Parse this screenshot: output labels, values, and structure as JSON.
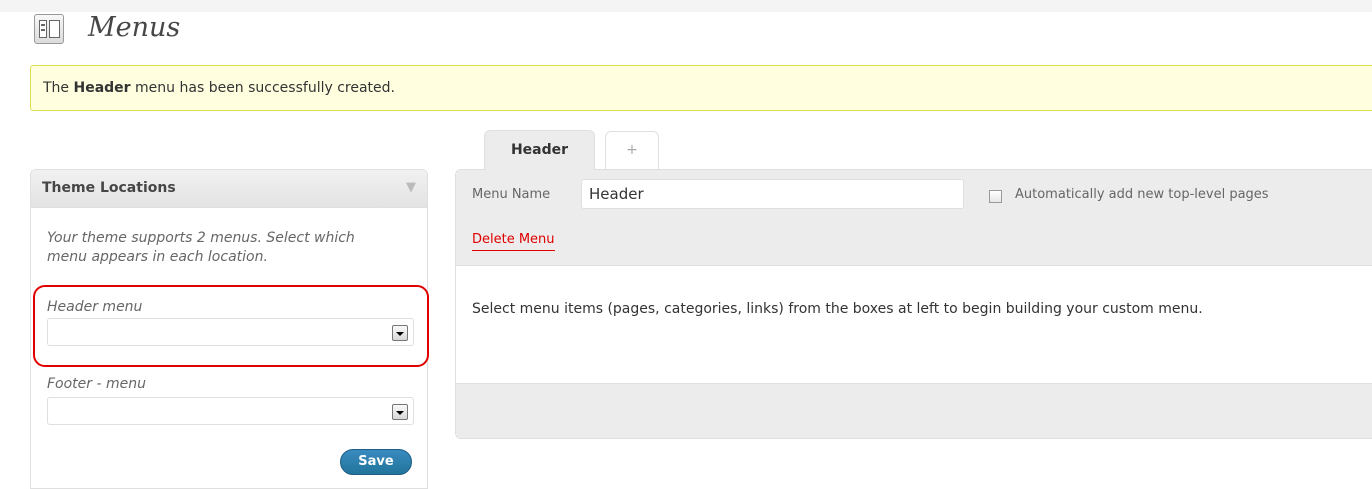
{
  "page": {
    "title": "Menus"
  },
  "notice": {
    "prefix": "The ",
    "bold": "Header",
    "suffix": " menu has been successfully created."
  },
  "tabs": [
    {
      "label": "Header",
      "active": true
    },
    {
      "label": "+",
      "active": false
    }
  ],
  "theme_locations": {
    "title": "Theme Locations",
    "toggle": "▼",
    "description": "Your theme supports 2 menus. Select which menu appears in each location.",
    "locations": [
      {
        "label": "Header menu",
        "selected": ""
      },
      {
        "label": "Footer - menu",
        "selected": ""
      }
    ],
    "save_label": "Save"
  },
  "menu_edit": {
    "name_label": "Menu Name",
    "name_value": "Header",
    "auto_add_label": "Automatically add new top-level pages",
    "auto_add_checked": false,
    "delete_label": "Delete Menu",
    "instructions": "Select menu items (pages, categories, links) from the boxes at left to begin building your custom menu."
  },
  "colors": {
    "notice_bg": "#ffffe0",
    "notice_border": "#e6db55",
    "highlight": "#e00000",
    "delete_link": "#e00000",
    "save_button": "#21759b"
  }
}
